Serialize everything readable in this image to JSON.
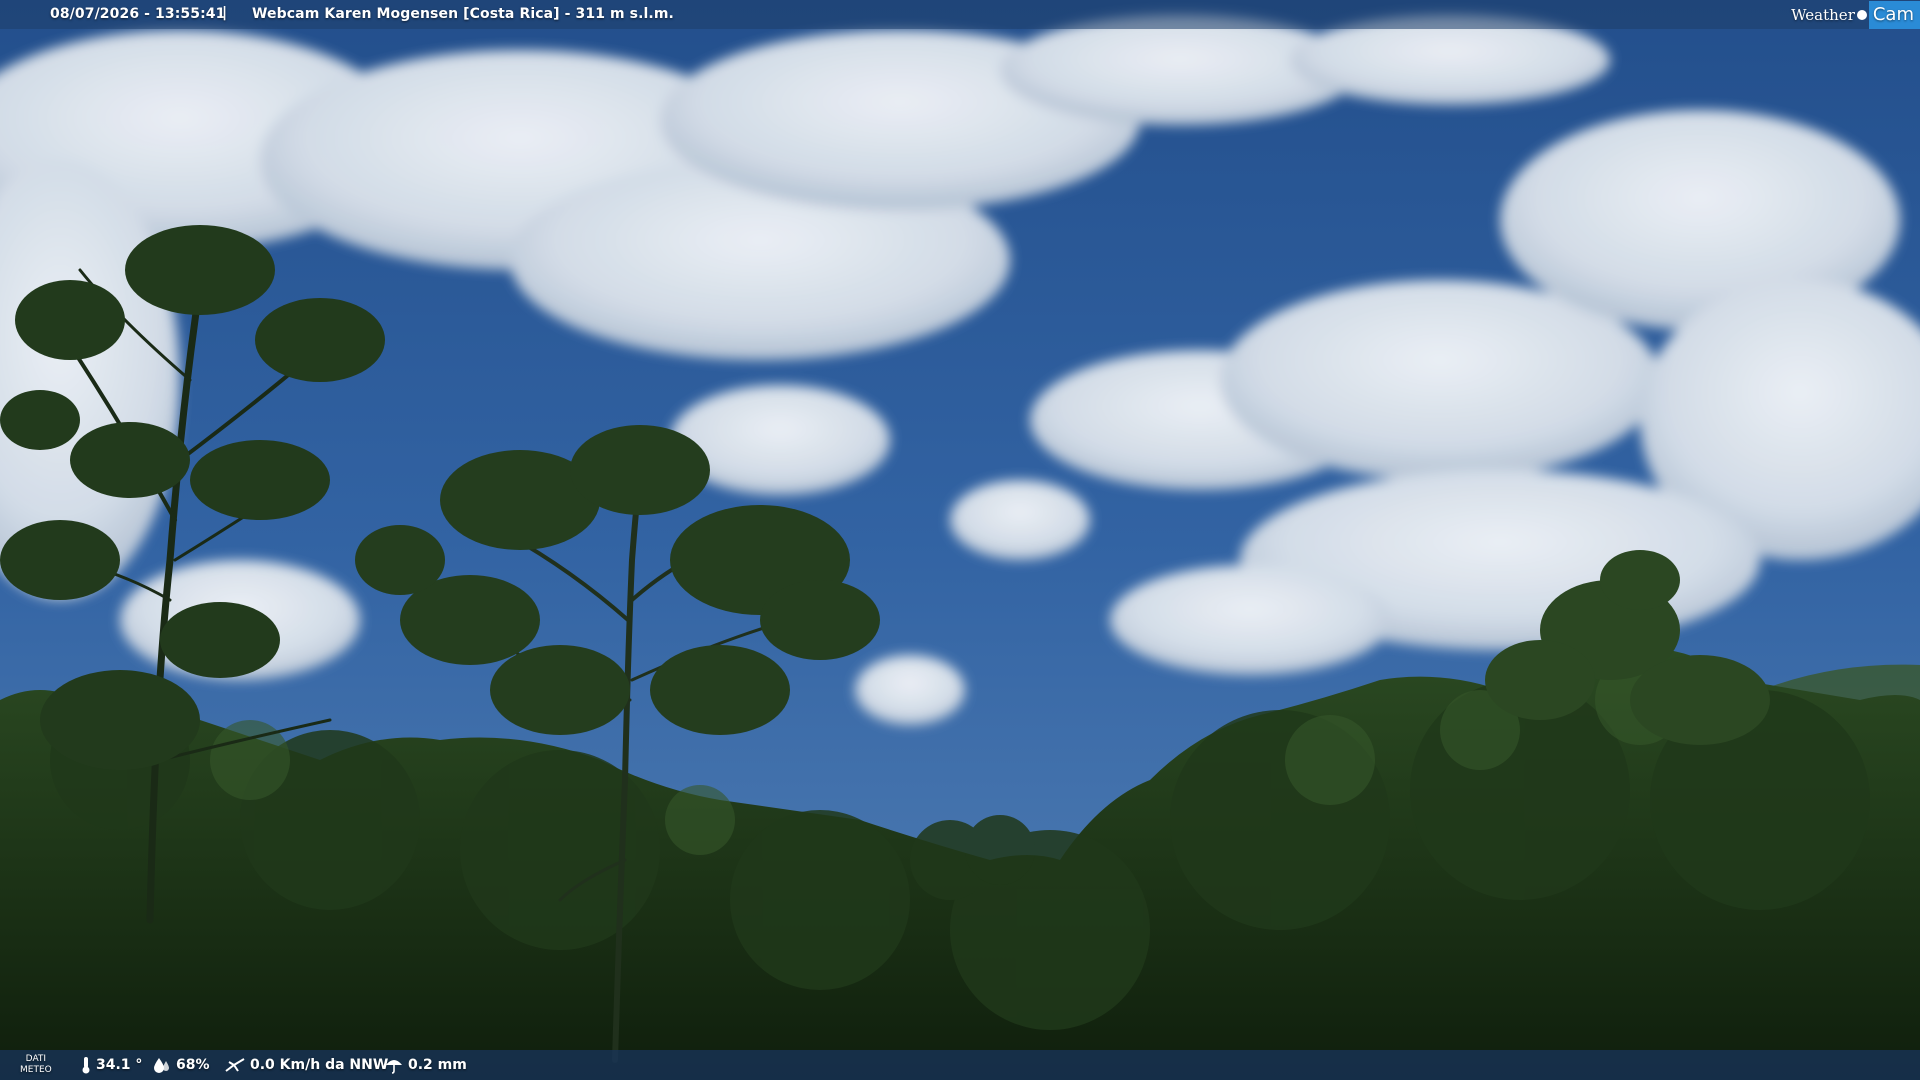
{
  "header": {
    "timestamp": "08/07/2026 - 13:55:41",
    "separator": "|",
    "title": "Webcam Karen Mogensen [Costa Rica] - 311 m s.l.m."
  },
  "logo": {
    "word1": "Weather",
    "word2": "Cam"
  },
  "weather": {
    "label_line1": "DATI",
    "label_line2": "METEO",
    "temperature": "34.1 °",
    "humidity": "68%",
    "wind": "0.0 Km/h da NNW",
    "rain": "0.2 mm"
  },
  "icons": {
    "temperature": "thermometer-icon",
    "humidity": "humidity-drop-icon",
    "wind": "wind-icon",
    "rain": "umbrella-icon"
  },
  "colors": {
    "sky": "#2c5fa0",
    "cloud": "#e6ecf3",
    "foliage": "#1c3316",
    "bar": "#1e3e69",
    "logo_accent": "#2a8bd6"
  }
}
